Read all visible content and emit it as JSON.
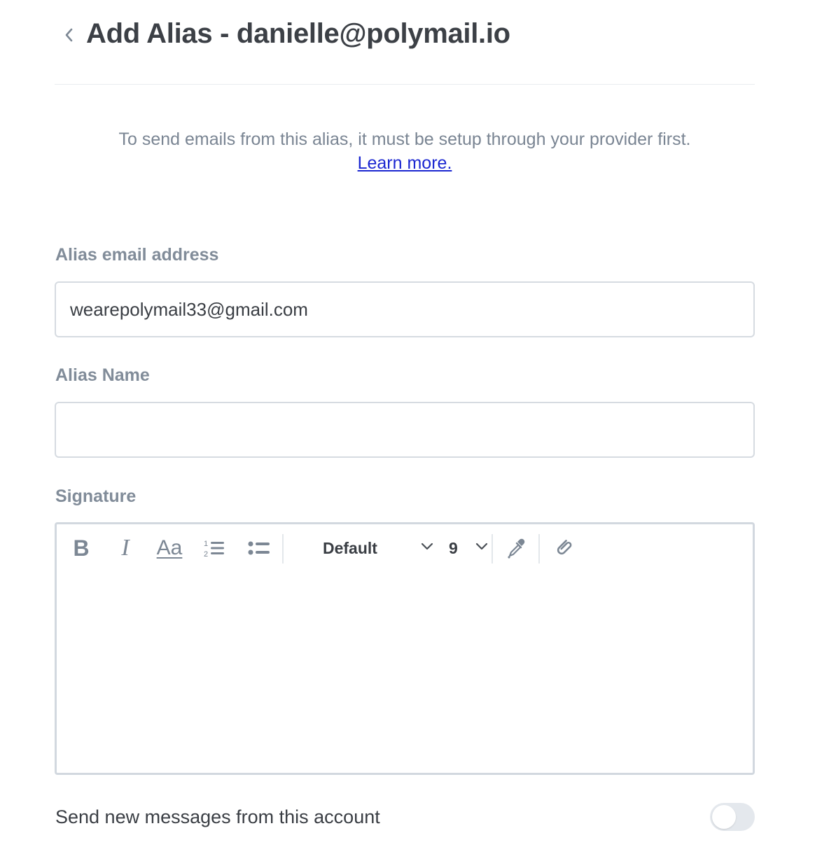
{
  "header": {
    "title": "Add Alias - danielle@polymail.io"
  },
  "notice": {
    "text": "To send emails from this alias, it must be setup through your provider first.",
    "link_label": "Learn more."
  },
  "form": {
    "alias_email": {
      "label": "Alias email address",
      "value": "wearepolymail33@gmail.com"
    },
    "alias_name": {
      "label": "Alias Name",
      "value": ""
    },
    "signature": {
      "label": "Signature",
      "toolbar": {
        "bold_label": "B",
        "italic_label": "I",
        "font_size_style_label": "Aa",
        "font_family": "Default",
        "font_size": "9"
      },
      "content": ""
    }
  },
  "send_from_account": {
    "label": "Send new messages from this account",
    "enabled": false
  },
  "colors": {
    "link": "#1a26d1",
    "label": "#818c99",
    "toggle_off": "#e4e8ed"
  }
}
